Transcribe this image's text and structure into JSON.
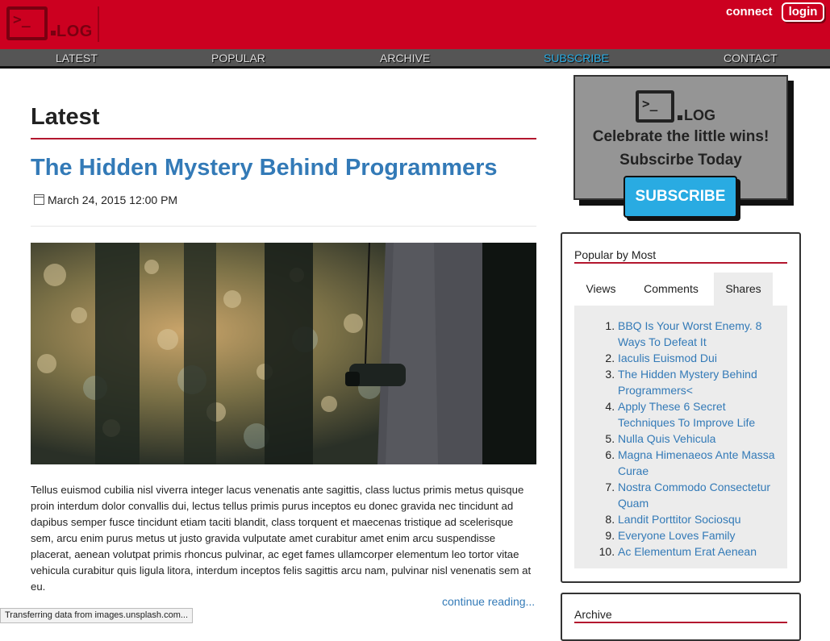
{
  "header": {
    "logo_word": "LOG",
    "logo_prompt": ">_",
    "connect_label": "connect",
    "login_label": "login"
  },
  "nav": {
    "items": [
      {
        "label": "LATEST",
        "active": false
      },
      {
        "label": "POPULAR",
        "active": false
      },
      {
        "label": "ARCHIVE",
        "active": false
      },
      {
        "label": "SUBSCRIBE",
        "active": true
      },
      {
        "label": "CONTACT",
        "active": false
      }
    ]
  },
  "main": {
    "section_title": "Latest",
    "post": {
      "title": "The Hidden Mystery Behind Programmers",
      "date": "March 24, 2015 12:00 PM",
      "body": "Tellus euismod cubilia nisl viverra integer lacus venenatis ante sagittis, class luctus primis metus quisque proin interdum dolor convallis dui, lectus tellus primis purus inceptos eu donec gravida nec tincidunt ad dapibus semper fusce tincidunt etiam taciti blandit, class torquent et maecenas tristique ad scelerisque sem, arcu enim purus metus ut justo gravida vulputate amet curabitur amet enim arcu suspendisse placerat, aenean volutpat primis rhoncus pulvinar, ac eget fames ullamcorper elementum leo tortor vitae vehicula curabitur quis ligula litora, interdum inceptos felis sagittis arcu nam, pulvinar nisl venenatis sem at eu.",
      "read_more": "continue reading..."
    }
  },
  "promo": {
    "logo_word": "LOG",
    "logo_prompt": ">_",
    "line1": "Celebrate the little wins!",
    "line2": "Subscirbe Today",
    "button": "SUBSCRIBE"
  },
  "popular": {
    "title": "Popular by Most",
    "tabs": [
      {
        "label": "Views",
        "active": false
      },
      {
        "label": "Comments",
        "active": false
      },
      {
        "label": "Shares",
        "active": true
      }
    ],
    "items": [
      "BBQ Is Your Worst Enemy. 8 Ways To Defeat It",
      "Iaculis Euismod Dui",
      "The Hidden Mystery Behind Programmers<",
      "Apply These 6 Secret Techniques To Improve Life",
      "Nulla Quis Vehicula",
      "Magna Himenaeos Ante Massa Curae",
      "Nostra Commodo Consectetur Quam",
      "Landit Porttitor Sociosqu",
      "Everyone Loves Family",
      "Ac Elementum Erat Aenean"
    ]
  },
  "archive": {
    "title": "Archive"
  },
  "status": {
    "text": "Transferring data from images.unsplash.com..."
  },
  "colors": {
    "brand_red": "#cc0020",
    "accent_blue": "#29abe2",
    "link_blue": "#337ab7",
    "rule_red": "#b3162e"
  }
}
